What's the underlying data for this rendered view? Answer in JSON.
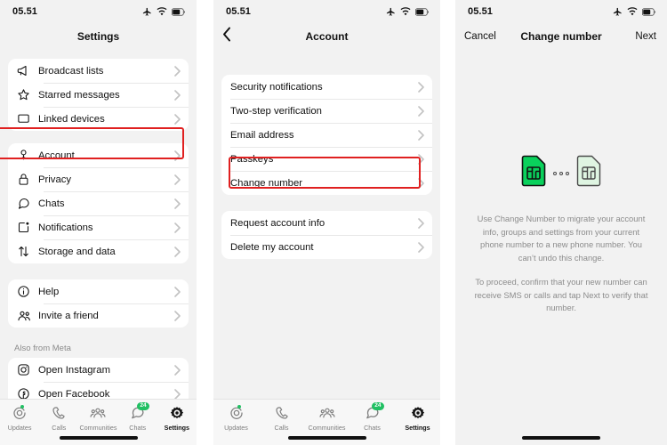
{
  "status_bar": {
    "time": "05.51",
    "icons": [
      "airplane-mode-icon",
      "wifi-icon",
      "battery-icon"
    ]
  },
  "colors": {
    "accent_green": "#21c063",
    "highlight_red": "#e02020",
    "panel_background": "#f2f2f2",
    "card_background": "#ffffff",
    "secondary_text": "#8c8c8c"
  },
  "panel_settings": {
    "title": "Settings",
    "groups": [
      {
        "rows": [
          {
            "label": "Broadcast lists",
            "icon": "megaphone-icon"
          },
          {
            "label": "Starred messages",
            "icon": "star-icon"
          },
          {
            "label": "Linked devices",
            "icon": "laptop-icon"
          }
        ]
      },
      {
        "rows": [
          {
            "label": "Account",
            "icon": "key-icon"
          },
          {
            "label": "Privacy",
            "icon": "lock-icon"
          },
          {
            "label": "Chats",
            "icon": "chat-bubble-icon"
          },
          {
            "label": "Notifications",
            "icon": "notifications-icon"
          },
          {
            "label": "Storage and data",
            "icon": "arrows-updown-icon"
          }
        ]
      },
      {
        "rows": [
          {
            "label": "Help",
            "icon": "info-circle-icon"
          },
          {
            "label": "Invite a friend",
            "icon": "people-icon"
          }
        ]
      }
    ],
    "section_title": "Also from Meta",
    "meta_group": {
      "rows": [
        {
          "label": "Open Instagram",
          "icon": "instagram-icon"
        },
        {
          "label": "Open Facebook",
          "icon": "facebook-icon"
        }
      ]
    },
    "highlighted_row": "Account"
  },
  "panel_account": {
    "title": "Account",
    "back_icon": "chevron-left-icon",
    "groups": [
      {
        "rows": [
          {
            "label": "Security notifications"
          },
          {
            "label": "Two-step verification"
          },
          {
            "label": "Email address"
          },
          {
            "label": "Passkeys"
          },
          {
            "label": "Change number"
          }
        ]
      },
      {
        "rows": [
          {
            "label": "Request account info"
          },
          {
            "label": "Delete my account"
          }
        ]
      }
    ],
    "highlighted_row": "Change number"
  },
  "panel_change_number": {
    "title": "Change number",
    "cancel_label": "Cancel",
    "next_label": "Next",
    "illustration": [
      "sim-card-filled-icon",
      "ellipsis-icon",
      "sim-card-outline-icon"
    ],
    "paragraphs": [
      "Use Change Number to migrate your account info, groups and settings from your current phone number to a new phone number. You can’t undo this change.",
      "To proceed, confirm that your new number can receive SMS or calls and tap Next to verify that number."
    ]
  },
  "tab_bar": {
    "tabs": [
      {
        "label": "Updates",
        "icon": "updates-icon",
        "badge": "",
        "dot": true,
        "active": false
      },
      {
        "label": "Calls",
        "icon": "phone-icon",
        "badge": "",
        "dot": false,
        "active": false
      },
      {
        "label": "Communities",
        "icon": "communities-icon",
        "badge": "",
        "dot": false,
        "active": false
      },
      {
        "label": "Chats",
        "icon": "chats-icon",
        "badge": "24",
        "dot": false,
        "active": false
      },
      {
        "label": "Settings",
        "icon": "gear-icon",
        "badge": "",
        "dot": false,
        "active": true
      }
    ]
  }
}
